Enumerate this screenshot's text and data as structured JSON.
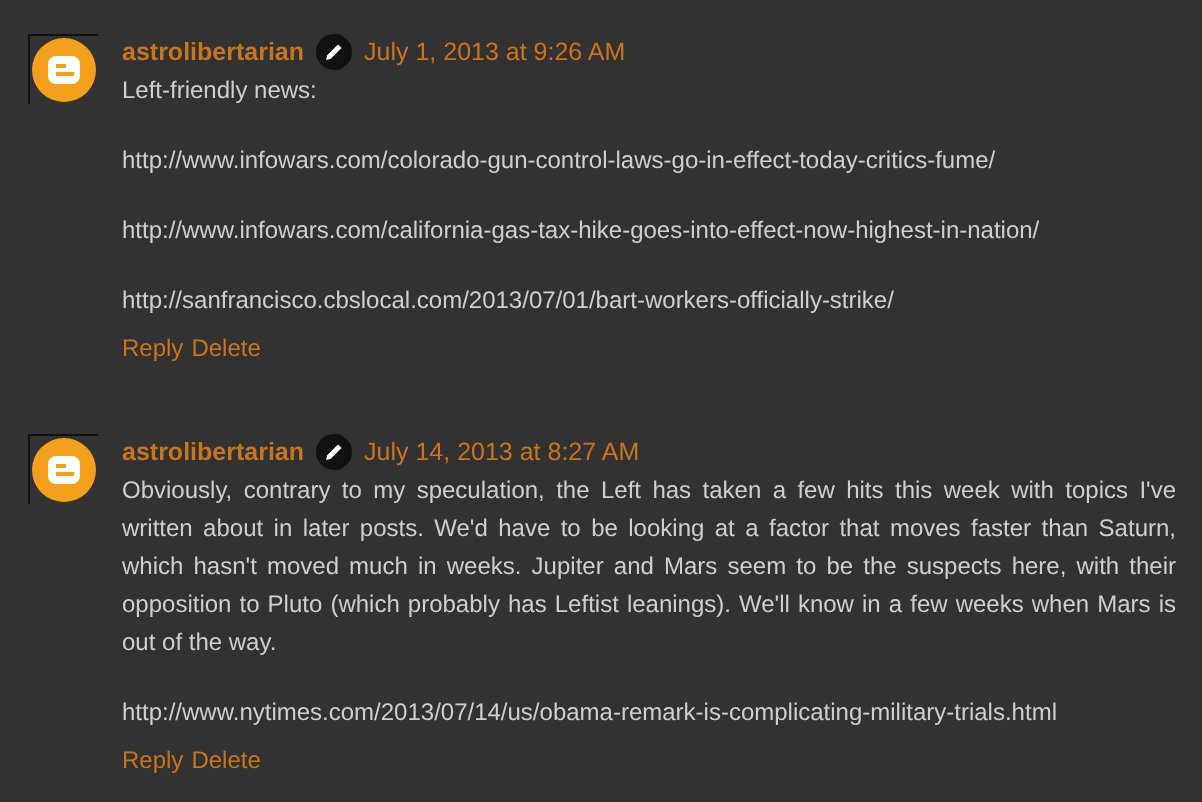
{
  "comments": [
    {
      "author": "astrolibertarian",
      "date": "July 1, 2013 at 9:26 AM",
      "paragraphs": [
        "Left-friendly news:",
        "http://www.infowars.com/colorado-gun-control-laws-go-in-effect-today-critics-fume/",
        "http://www.infowars.com/california-gas-tax-hike-goes-into-effect-now-highest-in-nation/",
        "http://sanfrancisco.cbslocal.com/2013/07/01/bart-workers-officially-strike/"
      ],
      "actions": [
        "Reply",
        "Delete"
      ]
    },
    {
      "author": "astrolibertarian",
      "date": "July 14, 2013 at 8:27 AM",
      "paragraphs": [
        "Obviously, contrary to my speculation, the Left has taken a few hits this week with topics I've written about in later posts. We'd have to be looking at a factor that moves faster than Saturn, which hasn't moved much in weeks. Jupiter and Mars seem to be the suspects here, with their opposition to Pluto (which probably has Leftist leanings). We'll know in a few weeks when Mars is out of the way.",
        "http://www.nytimes.com/2013/07/14/us/obama-remark-is-complicating-military-trials.html"
      ],
      "actions": [
        "Reply",
        "Delete"
      ]
    }
  ]
}
